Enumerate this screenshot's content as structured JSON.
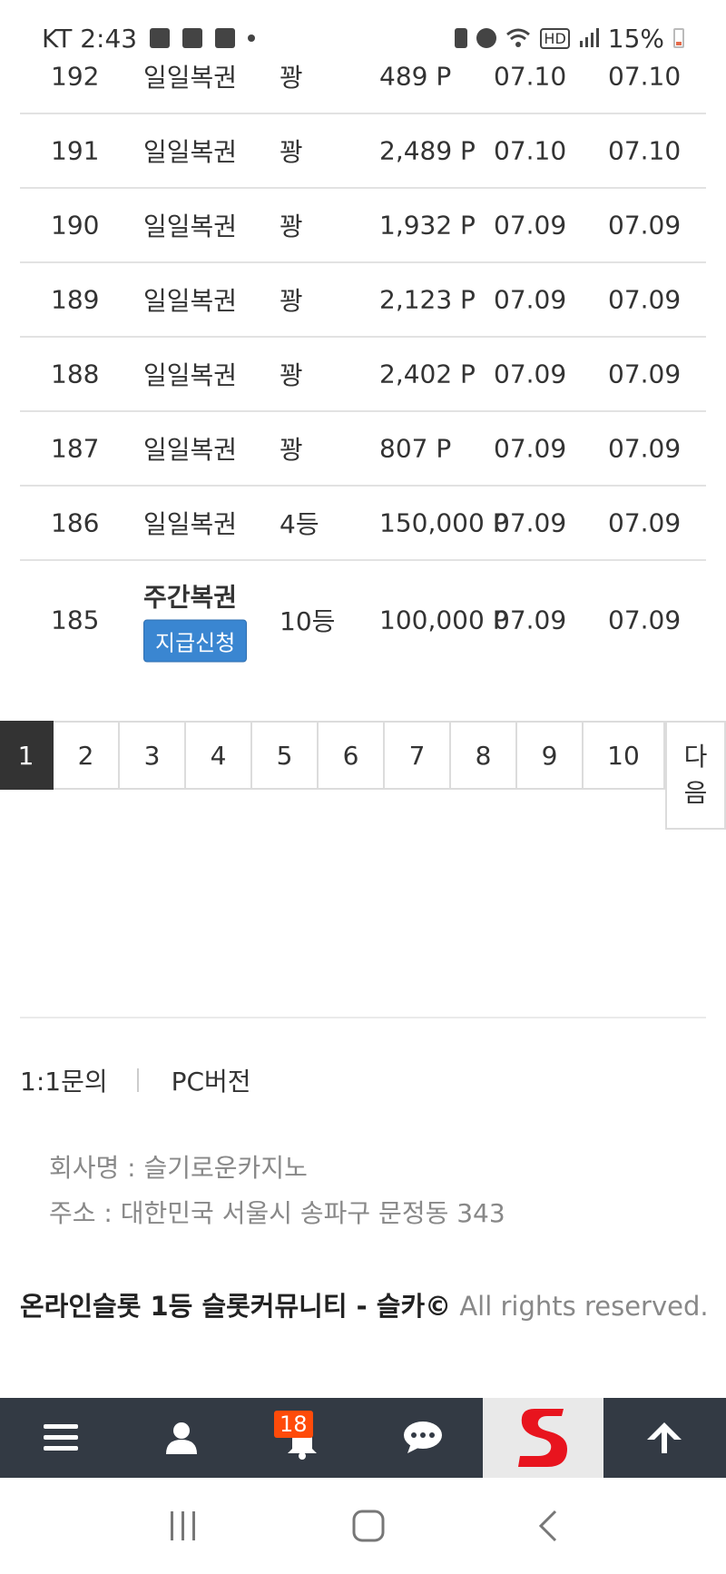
{
  "status_bar": {
    "carrier_time": "KT 2:43",
    "battery_percent": "15%"
  },
  "rows": [
    {
      "no": "192",
      "type": "일일복권",
      "rank": "꽝",
      "points": "489 P",
      "date1": "07.10",
      "date2": "07.10"
    },
    {
      "no": "191",
      "type": "일일복권",
      "rank": "꽝",
      "points": "2,489 P",
      "date1": "07.10",
      "date2": "07.10"
    },
    {
      "no": "190",
      "type": "일일복권",
      "rank": "꽝",
      "points": "1,932 P",
      "date1": "07.09",
      "date2": "07.09"
    },
    {
      "no": "189",
      "type": "일일복권",
      "rank": "꽝",
      "points": "2,123 P",
      "date1": "07.09",
      "date2": "07.09"
    },
    {
      "no": "188",
      "type": "일일복권",
      "rank": "꽝",
      "points": "2,402 P",
      "date1": "07.09",
      "date2": "07.09"
    },
    {
      "no": "187",
      "type": "일일복권",
      "rank": "꽝",
      "points": "807 P",
      "date1": "07.09",
      "date2": "07.09"
    },
    {
      "no": "186",
      "type": "일일복권",
      "rank": "4등",
      "points": "150,000 P",
      "date1": "07.09",
      "date2": "07.09"
    },
    {
      "no": "185",
      "type": "주간복권",
      "rank": "10등",
      "points": "100,000 P",
      "date1": "07.09",
      "date2": "07.09",
      "button": "지급신청"
    }
  ],
  "pagination": {
    "pages": [
      "1",
      "2",
      "3",
      "4",
      "5",
      "6",
      "7",
      "8",
      "9",
      "10"
    ],
    "active": "1",
    "next_line1": "다",
    "next_line2": "음"
  },
  "footer": {
    "link_inquiry": "1:1문의",
    "link_pc": "PC버전",
    "company": "회사명 : 슬기로운카지노",
    "address": "주소 : 대한민국 서울시 송파구 문정동 343",
    "copyright_bold": "온라인슬롯 1등 슬롯커뮤니티 - 슬카©",
    "copyright_light": " All rights reserved."
  },
  "app_bar": {
    "notification_count": "18"
  },
  "colors": {
    "app_bar_bg": "#333a44",
    "badge": "#ff4b0a",
    "claim_button": "#3a86d1",
    "logo_red": "#e8141e"
  }
}
